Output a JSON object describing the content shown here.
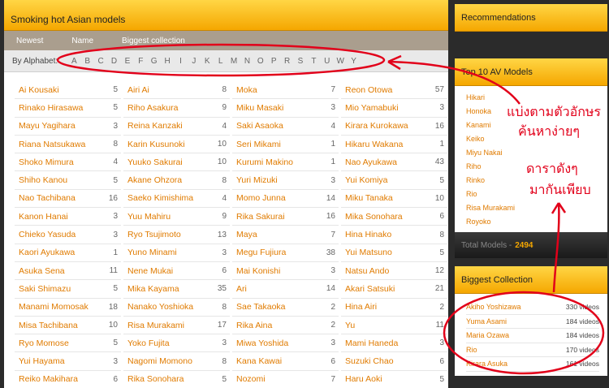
{
  "main": {
    "title": "Smoking hot Asian models",
    "sort_tabs": [
      "Newest",
      "Name",
      "Biggest collection"
    ],
    "alphabet_label": "By Alphabet:",
    "letters": [
      "A",
      "B",
      "C",
      "D",
      "E",
      "F",
      "G",
      "H",
      "I",
      "J",
      "K",
      "L",
      "M",
      "N",
      "O",
      "P",
      "R",
      "S",
      "T",
      "U",
      "W",
      "Y"
    ],
    "columns": [
      [
        {
          "name": "Ai Kousaki",
          "count": "5"
        },
        {
          "name": "Rinako Hirasawa",
          "count": "5"
        },
        {
          "name": "Mayu Yagihara",
          "count": "3"
        },
        {
          "name": "Riana Natsukawa",
          "count": "8"
        },
        {
          "name": "Shoko Mimura",
          "count": "4"
        },
        {
          "name": "Shiho Kanou",
          "count": "5"
        },
        {
          "name": "Nao Tachibana",
          "count": "16"
        },
        {
          "name": "Kanon Hanai",
          "count": "3"
        },
        {
          "name": "Chieko Yasuda",
          "count": "3"
        },
        {
          "name": "Kaori Ayukawa",
          "count": "1"
        },
        {
          "name": "Asuka Sena",
          "count": "11"
        },
        {
          "name": "Saki Shimazu",
          "count": "5"
        },
        {
          "name": "Manami Momosak",
          "count": "18"
        },
        {
          "name": "Misa Tachibana",
          "count": "10"
        },
        {
          "name": "Ryo Momose",
          "count": "5"
        },
        {
          "name": "Yui Hayama",
          "count": "3"
        },
        {
          "name": "Reiko Makihara",
          "count": "6"
        }
      ],
      [
        {
          "name": "Airi Ai",
          "count": "8"
        },
        {
          "name": "Riho Asakura",
          "count": "9"
        },
        {
          "name": "Reina Kanzaki",
          "count": "4"
        },
        {
          "name": "Karin Kusunoki",
          "count": "10"
        },
        {
          "name": "Yuuko Sakurai",
          "count": "10"
        },
        {
          "name": "Akane Ohzora",
          "count": "8"
        },
        {
          "name": "Saeko Kimishima",
          "count": "4"
        },
        {
          "name": "Yuu Mahiru",
          "count": "9"
        },
        {
          "name": "Ryo Tsujimoto",
          "count": "13"
        },
        {
          "name": "Yuno Minami",
          "count": "3"
        },
        {
          "name": "Nene Mukai",
          "count": "6"
        },
        {
          "name": "Mika Kayama",
          "count": "35"
        },
        {
          "name": "Nanako Yoshioka",
          "count": "8"
        },
        {
          "name": "Risa Murakami",
          "count": "17"
        },
        {
          "name": "Yoko Fujita",
          "count": "3"
        },
        {
          "name": "Nagomi Momono",
          "count": "8"
        },
        {
          "name": "Rika Sonohara",
          "count": "5"
        }
      ],
      [
        {
          "name": "Moka",
          "count": "7"
        },
        {
          "name": "Miku Masaki",
          "count": "3"
        },
        {
          "name": "Saki Asaoka",
          "count": "4"
        },
        {
          "name": "Seri Mikami",
          "count": "1"
        },
        {
          "name": "Kurumi Makino",
          "count": "1"
        },
        {
          "name": "Yuri Mizuki",
          "count": "3"
        },
        {
          "name": "Momo Junna",
          "count": "14"
        },
        {
          "name": "Rika Sakurai",
          "count": "16"
        },
        {
          "name": "Maya",
          "count": "7"
        },
        {
          "name": "Megu Fujiura",
          "count": "38"
        },
        {
          "name": "Mai Konishi",
          "count": "3"
        },
        {
          "name": "Ari",
          "count": "14"
        },
        {
          "name": "Sae Takaoka",
          "count": "2"
        },
        {
          "name": "Rika Aina",
          "count": "2"
        },
        {
          "name": "Miwa Yoshida",
          "count": "3"
        },
        {
          "name": "Kana Kawai",
          "count": "6"
        },
        {
          "name": "Nozomi",
          "count": "7"
        }
      ],
      [
        {
          "name": "Reon Otowa",
          "count": "57"
        },
        {
          "name": "Mio Yamabuki",
          "count": "3"
        },
        {
          "name": "Kirara Kurokawa",
          "count": "16"
        },
        {
          "name": "Hikaru Wakana",
          "count": "1"
        },
        {
          "name": "Nao Ayukawa",
          "count": "43"
        },
        {
          "name": "Yui Komiya",
          "count": "5"
        },
        {
          "name": "Miku Tanaka",
          "count": "10"
        },
        {
          "name": "Mika Sonohara",
          "count": "6"
        },
        {
          "name": "Hina Hinako",
          "count": "8"
        },
        {
          "name": "Yui Matsuno",
          "count": "5"
        },
        {
          "name": "Natsu Ando",
          "count": "12"
        },
        {
          "name": "Akari Satsuki",
          "count": "21"
        },
        {
          "name": "Hina Airi",
          "count": "2"
        },
        {
          "name": "Yu",
          "count": "11"
        },
        {
          "name": "Mami Haneda",
          "count": "3"
        },
        {
          "name": "Suzuki Chao",
          "count": "6"
        },
        {
          "name": "Haru Aoki",
          "count": "5"
        }
      ]
    ]
  },
  "sidebar": {
    "recommendations_title": "Recommendations",
    "top10_title": "Top 10 AV Models",
    "top10": [
      "Hikari",
      "Honoka",
      "Kanami",
      "Keiko",
      "Miyu Nakai",
      "Riho",
      "Rinko",
      "Rio",
      "Risa Murakami",
      "Royoko"
    ],
    "total_label": "Total Models -",
    "total_value": "2494",
    "biggest_title": "Biggest Collection",
    "biggest": [
      {
        "name": "Akiho Yoshizawa",
        "count": "330 videos"
      },
      {
        "name": "Yuma Asami",
        "count": "184 videos"
      },
      {
        "name": "Maria Ozawa",
        "count": "184 videos"
      },
      {
        "name": "Rio",
        "count": "170 videos"
      },
      {
        "name": "Kirara Asuka",
        "count": "161 videos"
      }
    ]
  },
  "annotations": {
    "note1_line1": "แบ่งตามตัวอักษร",
    "note1_line2": "ค้นหาง่ายๆ",
    "note2_line1": "ดาราดังๆ",
    "note2_line2": "มากันเพียบ",
    "ink_color": "#e2001a"
  }
}
